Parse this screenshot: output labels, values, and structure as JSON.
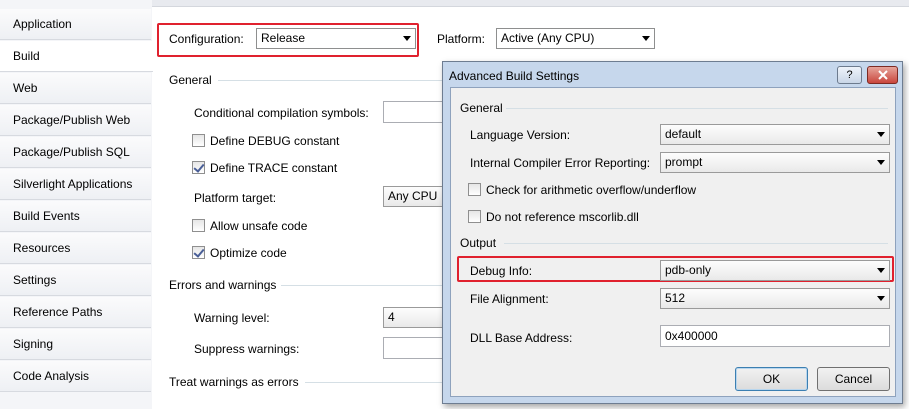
{
  "sidebar": {
    "tabs": [
      {
        "label": "Application"
      },
      {
        "label": "Build"
      },
      {
        "label": "Web"
      },
      {
        "label": "Package/Publish Web"
      },
      {
        "label": "Package/Publish SQL"
      },
      {
        "label": "Silverlight Applications"
      },
      {
        "label": "Build Events"
      },
      {
        "label": "Resources"
      },
      {
        "label": "Settings"
      },
      {
        "label": "Reference Paths"
      },
      {
        "label": "Signing"
      },
      {
        "label": "Code Analysis"
      }
    ],
    "active_index": 1
  },
  "build": {
    "configuration_label": "Configuration:",
    "configuration_value": "Release",
    "platform_label": "Platform:",
    "platform_value": "Active (Any CPU)",
    "general_header": "General",
    "conditional_symbols_label": "Conditional compilation symbols:",
    "conditional_symbols_value": "",
    "define_debug_label": "Define DEBUG constant",
    "define_debug_checked": false,
    "define_trace_label": "Define TRACE constant",
    "define_trace_checked": true,
    "platform_target_label": "Platform target:",
    "platform_target_value": "Any CPU",
    "allow_unsafe_label": "Allow unsafe code",
    "allow_unsafe_checked": false,
    "optimize_label": "Optimize code",
    "optimize_checked": true,
    "errors_header": "Errors and warnings",
    "warning_level_label": "Warning level:",
    "warning_level_value": "4",
    "suppress_label": "Suppress warnings:",
    "suppress_value": "",
    "treat_header": "Treat warnings as errors"
  },
  "dialog": {
    "title": "Advanced Build Settings",
    "help_label": "?",
    "general_header": "General",
    "language_version_label": "Language Version:",
    "language_version_value": "default",
    "ice_reporting_label": "Internal Compiler Error Reporting:",
    "ice_reporting_value": "prompt",
    "overflow_label": "Check for arithmetic overflow/underflow",
    "overflow_checked": false,
    "no_mscorlib_label": "Do not reference mscorlib.dll",
    "no_mscorlib_checked": false,
    "output_header": "Output",
    "debug_info_label": "Debug Info:",
    "debug_info_value": "pdb-only",
    "file_alignment_label": "File Alignment:",
    "file_alignment_value": "512",
    "dll_base_label": "DLL Base Address:",
    "dll_base_value": "0x400000",
    "ok_label": "OK",
    "cancel_label": "Cancel"
  },
  "colors": {
    "highlight_box": "#e0212e",
    "dialog_frame": "#c6d7ec",
    "close_button": "#c9463d"
  }
}
